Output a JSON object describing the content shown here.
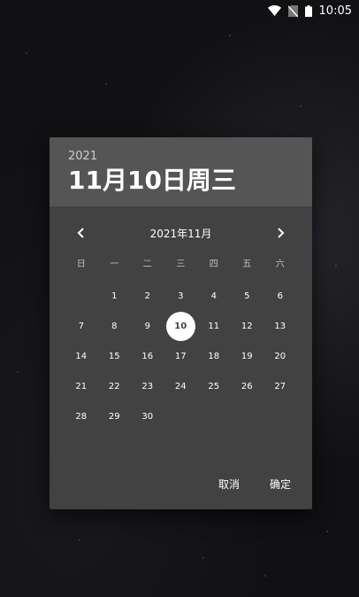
{
  "status_bar": {
    "time": "10:05"
  },
  "dialog": {
    "header": {
      "year": "2021",
      "date": "11月10日周三"
    },
    "month_title": "2021年11月",
    "weekdays": [
      "日",
      "一",
      "二",
      "三",
      "四",
      "五",
      "六"
    ],
    "weeks": [
      [
        "",
        "1",
        "2",
        "3",
        "4",
        "5",
        "6"
      ],
      [
        "7",
        "8",
        "9",
        "10",
        "11",
        "12",
        "13"
      ],
      [
        "14",
        "15",
        "16",
        "17",
        "18",
        "19",
        "20"
      ],
      [
        "21",
        "22",
        "23",
        "24",
        "25",
        "26",
        "27"
      ],
      [
        "28",
        "29",
        "30",
        "",
        "",
        "",
        ""
      ]
    ],
    "selected_day": "10",
    "cancel_label": "取消",
    "ok_label": "确定"
  }
}
